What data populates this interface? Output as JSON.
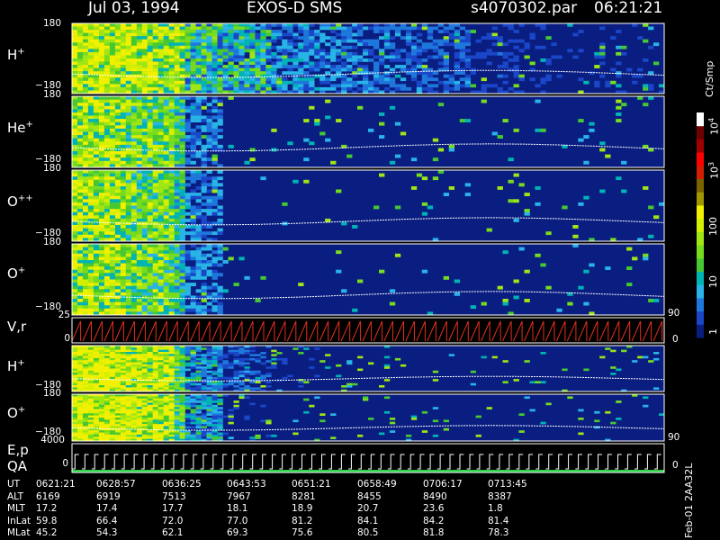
{
  "title": {
    "date": "Jul 03, 1994",
    "instrument": "EXOS-D SMS",
    "file": "s4070302.par",
    "time": "06:21:21"
  },
  "colorbar": {
    "unit": "Ct/Smp",
    "ticks": [
      "1",
      "10",
      "100",
      "10",
      "10"
    ],
    "tick_exp": [
      "",
      "",
      "",
      "3",
      "4"
    ],
    "colors": [
      "#0a1e82",
      "#1a46c8",
      "#1e78dc",
      "#28b4e6",
      "#00b4b4",
      "#46c832",
      "#78dc1e",
      "#a0e614",
      "#d2f000",
      "#f0f000",
      "#a09600",
      "#7a6400",
      "#d21e00",
      "#ff0000",
      "#a00000",
      "#6e0000",
      "#ffffff"
    ]
  },
  "chart_data": {
    "type": "heatmap",
    "panels": [
      {
        "label": "H",
        "sup": "+",
        "ymax": "180",
        "ymin": "−180",
        "kind": "pitch",
        "activity": [
          0.9,
          0.85,
          0.8,
          0.7,
          0.55,
          0.5,
          0.45,
          0.4,
          0.35,
          0.3,
          0.3,
          0.3
        ]
      },
      {
        "label": "He",
        "sup": "+",
        "ymax": "180",
        "ymin": "−180",
        "kind": "pitch",
        "activity": [
          0.8,
          0.7,
          0.5,
          0.2,
          0.1,
          0.1,
          0.1,
          0.1,
          0.1,
          0.1,
          0.1,
          0.1
        ]
      },
      {
        "label": "O",
        "sup": "++",
        "ymax": "180",
        "ymin": "−180",
        "kind": "pitch",
        "activity": [
          0.8,
          0.7,
          0.5,
          0.2,
          0.1,
          0.1,
          0.1,
          0.1,
          0.1,
          0.1,
          0.1,
          0.1
        ]
      },
      {
        "label": "O",
        "sup": "+",
        "ymax": "180",
        "ymin": "−180",
        "kind": "pitch",
        "activity": [
          0.8,
          0.7,
          0.5,
          0.2,
          0.1,
          0.1,
          0.1,
          0.1,
          0.1,
          0.1,
          0.1,
          0.1
        ]
      },
      {
        "label": "V,r",
        "sup": "",
        "ymax": "25",
        "ymin": "0",
        "rmax": "90",
        "rmin": "0",
        "kind": "sawtooth"
      },
      {
        "label": "H",
        "sup": "+",
        "ymax": "180",
        "ymin": "−180",
        "kind": "pitch",
        "activity": [
          1.0,
          0.9,
          0.6,
          0.4,
          0.3,
          0.2,
          0.1,
          0.05,
          0.05,
          0.05,
          0.05,
          0.05
        ]
      },
      {
        "label": "O",
        "sup": "+",
        "ymax": "180",
        "ymin": "−180",
        "kind": "pitch",
        "activity": [
          1.0,
          0.95,
          0.6,
          0.3,
          0.15,
          0.1,
          0.05,
          0.05,
          0.05,
          0.05,
          0.05,
          0.05
        ]
      },
      {
        "label": "E,p",
        "sub_label": "QA",
        "ymax": "4000",
        "ymin": "0",
        "rmax": "90",
        "rmin": "0",
        "kind": "steps"
      }
    ]
  },
  "footer": {
    "row_labels": [
      "UT",
      "ALT",
      "MLT",
      "InLat",
      "MLat"
    ],
    "columns": [
      [
        "0621:21",
        "6169",
        "17.2",
        "59.8",
        "45.2"
      ],
      [
        "0628:57",
        "6919",
        "17.4",
        "66.4",
        "54.3"
      ],
      [
        "0636:25",
        "7513",
        "17.7",
        "72.0",
        "62.1"
      ],
      [
        "0643:53",
        "7967",
        "18.1",
        "77.0",
        "69.3"
      ],
      [
        "0651:21",
        "8281",
        "18.9",
        "81.2",
        "75.6"
      ],
      [
        "0658:49",
        "8455",
        "20.7",
        "84.1",
        "80.5"
      ],
      [
        "0706:17",
        "8490",
        "23.6",
        "84.2",
        "81.8"
      ],
      [
        "0713:45",
        "8387",
        "1.8",
        "81.4",
        "78.3"
      ]
    ],
    "side_note": "Feb-01 2AA32L"
  }
}
